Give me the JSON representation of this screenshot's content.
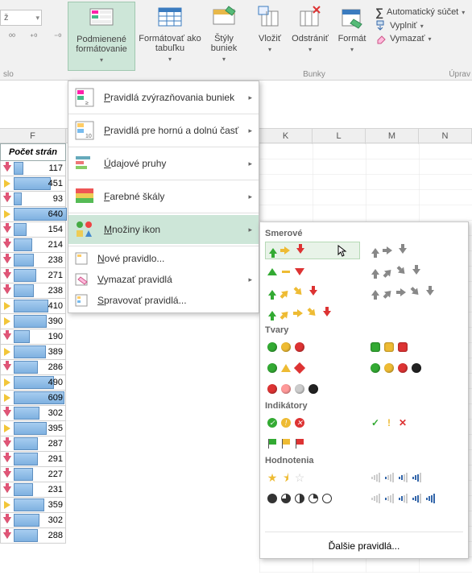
{
  "ribbon": {
    "conditional_formatting": "Podmienené formátovanie",
    "format_as_table": "Formátovať ako tabuľku",
    "cell_styles": "Štýly buniek",
    "insert": "Vložiť",
    "delete": "Odstrániť",
    "format": "Formát",
    "cells_group": "Bunky",
    "autosum": "Automatický súčet",
    "fill": "Vyplniť",
    "clear": "Vymazať",
    "edit_group": "Úprav",
    "number_group": "slo"
  },
  "col_header_F": "F",
  "col_header_K": "K",
  "col_header_L": "L",
  "col_header_M": "M",
  "col_header_N": "N",
  "table_header": "Počet strán",
  "rows": [
    {
      "dir": "down",
      "val": 117,
      "bar": 12
    },
    {
      "dir": "right",
      "val": 451,
      "bar": 46
    },
    {
      "dir": "down",
      "val": 93,
      "bar": 10
    },
    {
      "dir": "right",
      "val": 640,
      "bar": 66
    },
    {
      "dir": "down",
      "val": 154,
      "bar": 16
    },
    {
      "dir": "down",
      "val": 214,
      "bar": 23
    },
    {
      "dir": "down",
      "val": 238,
      "bar": 25
    },
    {
      "dir": "down",
      "val": 271,
      "bar": 28
    },
    {
      "dir": "down",
      "val": 238,
      "bar": 25
    },
    {
      "dir": "right",
      "val": 410,
      "bar": 43
    },
    {
      "dir": "right",
      "val": 390,
      "bar": 41
    },
    {
      "dir": "down",
      "val": 190,
      "bar": 20
    },
    {
      "dir": "right",
      "val": 389,
      "bar": 40
    },
    {
      "dir": "down",
      "val": 286,
      "bar": 30
    },
    {
      "dir": "right",
      "val": 490,
      "bar": 50
    },
    {
      "dir": "right",
      "val": 609,
      "bar": 63
    },
    {
      "dir": "down",
      "val": 302,
      "bar": 32
    },
    {
      "dir": "right",
      "val": 395,
      "bar": 41
    },
    {
      "dir": "down",
      "val": 287,
      "bar": 30
    },
    {
      "dir": "down",
      "val": 291,
      "bar": 30
    },
    {
      "dir": "down",
      "val": 227,
      "bar": 24
    },
    {
      "dir": "down",
      "val": 231,
      "bar": 24
    },
    {
      "dir": "right",
      "val": 359,
      "bar": 38
    },
    {
      "dir": "down",
      "val": 302,
      "bar": 32
    },
    {
      "dir": "down",
      "val": 288,
      "bar": 30
    }
  ],
  "menu": {
    "highlight_rules": "Pravidlá zvýrazňovania buniek",
    "top_bottom_rules": "Pravidlá pre hornú a dolnú časť",
    "data_bars": "Údajové pruhy",
    "color_scales": "Farebné škály",
    "icon_sets": "Množiny ikon",
    "new_rule": "Nové pravidlo...",
    "clear_rules": "Vymazať pravidlá",
    "manage_rules": "Spravovať pravidlá..."
  },
  "fly": {
    "directional": "Smerové",
    "shapes": "Tvary",
    "indicators": "Indikátory",
    "ratings": "Hodnotenia",
    "more_rules": "Ďalšie pravidlá..."
  }
}
